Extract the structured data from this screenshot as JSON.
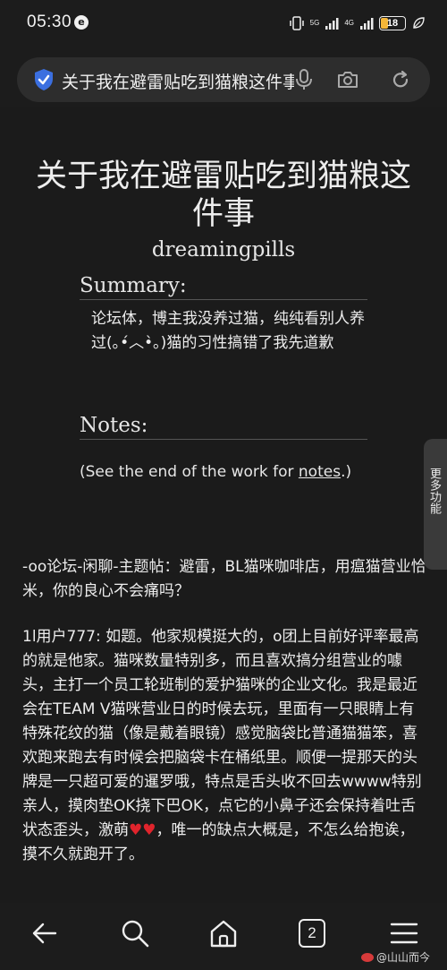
{
  "status_bar": {
    "time": "05:30",
    "app_badge": "e",
    "net_left": "5G",
    "net_right": "4G",
    "battery": "18"
  },
  "address_bar": {
    "title": "关于我在避雷贴吃到猫粮这件事"
  },
  "work": {
    "title": "关于我在避雷贴吃到猫粮这件事",
    "author": "dreamingpills",
    "summary_heading": "Summary:",
    "summary_text": "论坛体，博主我没养过猫，纯纯看别人养过(｡•́︿•̀｡)猫的习性搞错了我先道歉",
    "notes_heading": "Notes:",
    "notes_prefix": "(See the end of the work for ",
    "notes_link": "notes",
    "notes_suffix": ".)"
  },
  "body": {
    "paragraph1": "-oo论坛-闲聊-主题帖：避雷，BL猫咪咖啡店，用瘟猫营业恰米，你的良心不会痛吗？",
    "paragraph2": "1l用户777: 如题。他家规模挺大的，o团上目前好评率最高的就是他家。猫咪数量特别多，而且喜欢搞分组营业的噱头，主打一个员工轮班制的爱护猫咪的企业文化。我是最近会在TEAM V猫咪营业日的时候去玩，里面有一只眼睛上有特殊花纹的猫（像是戴着眼镜）感觉脑袋比普通猫猫笨，喜欢跑来跑去有时候会把脑袋卡在桶纸里。顺便一提那天的头牌是一只超可爱的暹罗哦，特点是舌头收不回去wwww特别亲人，摸肉垫OK挠下巴OK，点它的小鼻子还会保持着吐舌状态歪头，激萌",
    "hearts": "♥♥",
    "paragraph2_end": "，唯一的缺点大概是，不怎么给抱诶，摸不久就跑开了。"
  },
  "side_tab": {
    "label": "更多功能"
  },
  "bottom_nav": {
    "tabs_count": "2"
  },
  "watermark": {
    "text": "@山山而今"
  }
}
